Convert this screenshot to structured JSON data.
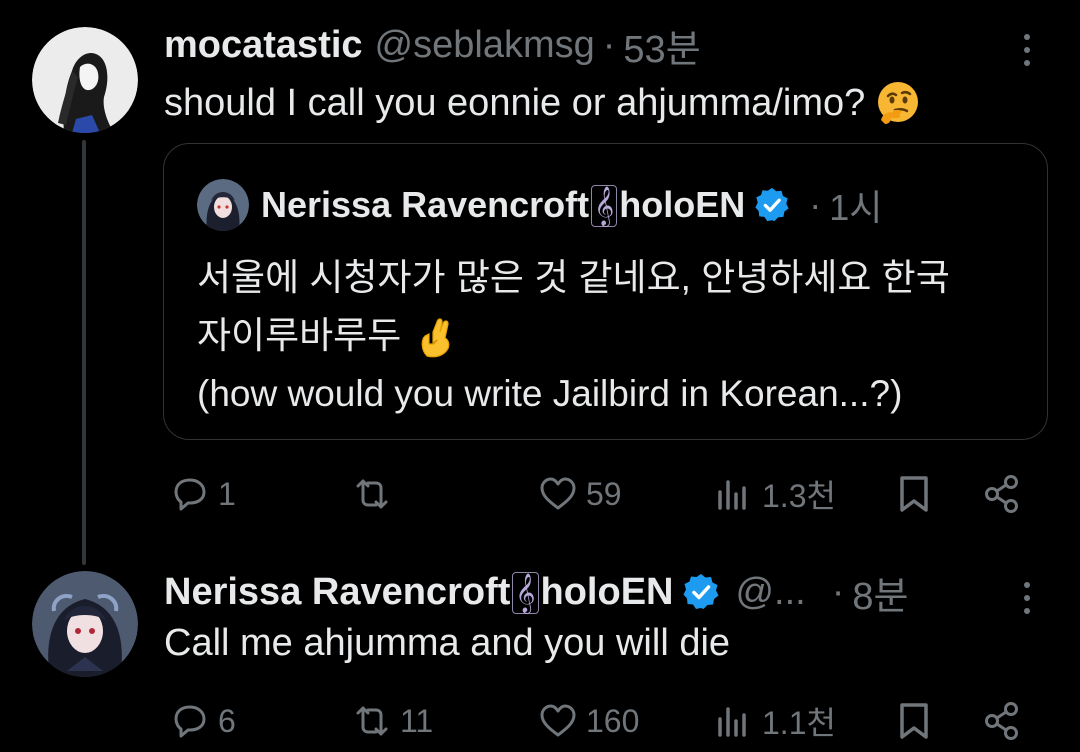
{
  "tweets": [
    {
      "display_name": "mocatastic",
      "handle": "@seblakmsg",
      "separator": "·",
      "time": "53분",
      "text": "should I call you eonnie or ahjumma/imo?",
      "emoji": "thinking-face",
      "stats": {
        "replies": "1",
        "retweets": "",
        "likes": "59",
        "views": "1.3천"
      },
      "quoted": {
        "display_name_prefix": "Nerissa Ravencroft",
        "clef": "𝄞",
        "display_name_suffix": "holoEN",
        "separator": "·",
        "time": "1시",
        "lines": [
          "서울에 시청자가 많은 것 같네요, 안녕하세요 한국",
          "자이루바루두",
          "(how would you write Jailbird in Korean...?)"
        ],
        "emoji": "crossed-fingers"
      }
    },
    {
      "display_name_prefix": "Nerissa Ravencroft",
      "clef": "𝄞",
      "display_name_suffix": "holoEN",
      "handle": "@...",
      "separator": "·",
      "time": "8분",
      "text": "Call me ahjumma and you will die",
      "stats": {
        "replies": "6",
        "retweets": "11",
        "likes": "160",
        "views": "1.1천"
      }
    }
  ],
  "colors": {
    "background": "#000000",
    "text": "#e7e9ea",
    "muted": "#71767b",
    "verified": "#1d9bf0",
    "border": "#2f3336"
  }
}
